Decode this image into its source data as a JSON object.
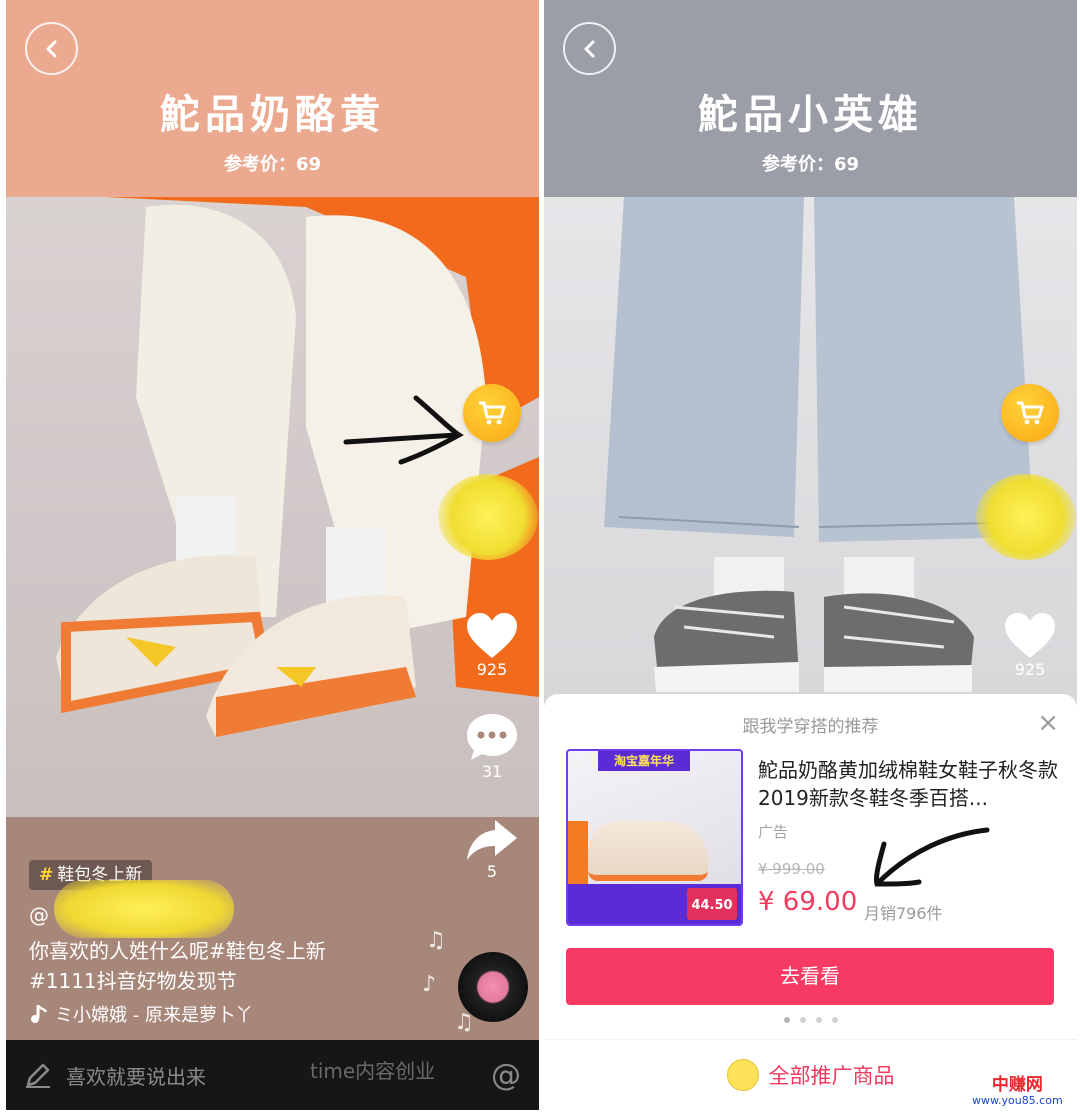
{
  "left": {
    "title": "鮀品奶酪黄",
    "ref_price": "参考价：69",
    "likes": "925",
    "comments": "31",
    "shares": "5",
    "tag": "鞋包冬上新",
    "handle": "@",
    "caption_line1": "你喜欢的人姓什么呢#鞋包冬上新",
    "caption_line2": "#1111抖音好物发现节",
    "music": "ミ小嫦娥 - 原来是萝卜丫",
    "comment_placeholder": "喜欢就要说出来",
    "at_symbol": "@"
  },
  "right": {
    "title": "鮀品小英雄",
    "ref_price": "参考价：69",
    "likes": "925",
    "sheet_header": "跟我学穿搭的推荐",
    "close": "×",
    "product_title": "鮀品奶酪黄加绒棉鞋女鞋子秋冬款2019新款冬鞋冬季百搭...",
    "ad_label": "广告",
    "original_price": "¥ 999.00",
    "price": "¥ 69.00",
    "monthly_sales": "月销796件",
    "cta": "去看看",
    "all_text": "全部推广商品",
    "promo_banner": "淘宝嘉年华",
    "badge_price": "44.50"
  },
  "watermark": "time内容创业",
  "site_mark": {
    "cn": "中赚网",
    "url": "www.you85.com"
  },
  "colors": {
    "accent": "#f73a64",
    "price": "#f23a5f",
    "cart": "#f9a813",
    "left_header": "#eba98f",
    "right_header": "#9b9ea7"
  },
  "icons": [
    "back-icon",
    "cart-icon",
    "heart-icon",
    "comment-icon",
    "share-icon",
    "music-note-icon",
    "pencil-icon",
    "close-icon"
  ]
}
